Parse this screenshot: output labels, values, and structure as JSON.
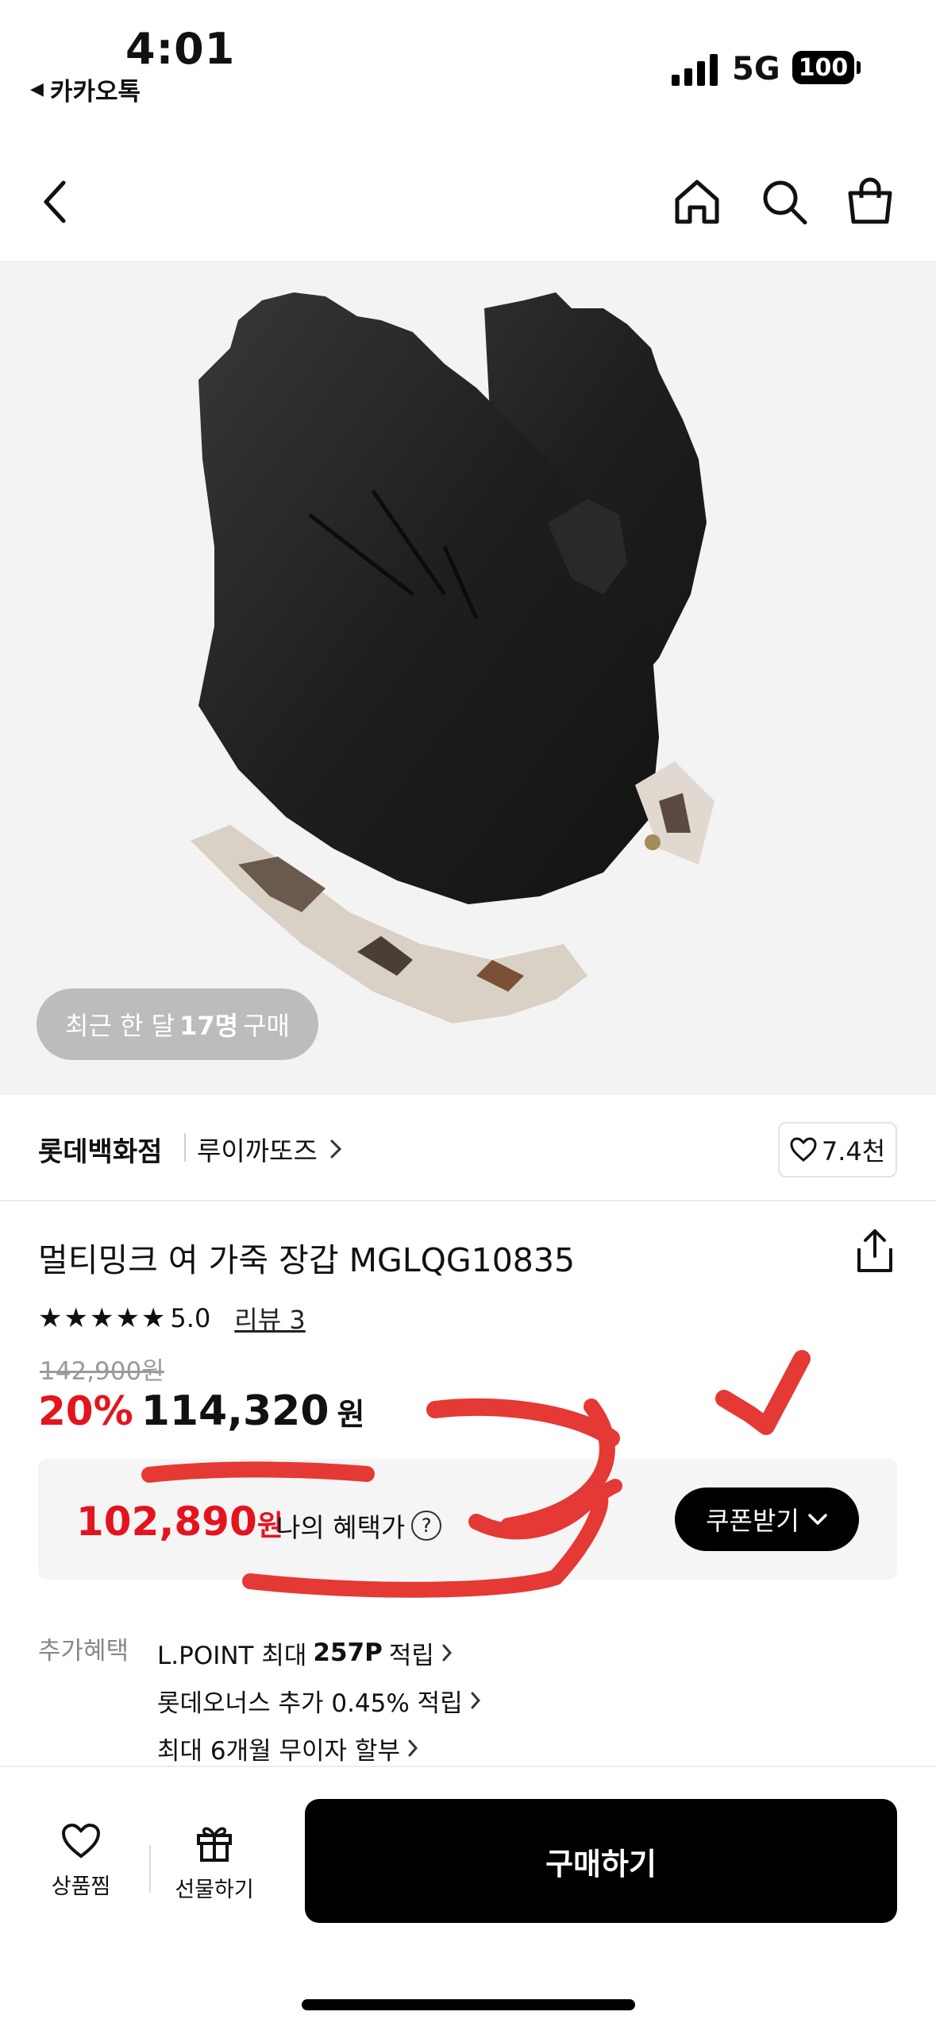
{
  "status_bar": {
    "time": "4:01",
    "back_app": "카카오톡",
    "network": "5G",
    "battery": "100"
  },
  "header": {
    "icons": [
      "back-icon",
      "home-icon",
      "search-icon",
      "shopping-bag-icon"
    ]
  },
  "product_image": {
    "recent_prefix": "최근 한 달",
    "recent_count": "17명",
    "recent_suffix": "구매"
  },
  "brand": {
    "store": "롯데백화점",
    "name": "루이까또즈",
    "likes": "7.4천"
  },
  "product": {
    "title": "멀티밍크 여 가죽 장갑 MGLQG10835",
    "stars": "★★★★★",
    "rating": "5.0",
    "review_label": "리뷰 3",
    "original_price": "142,900원",
    "discount": "20%",
    "sale_price": "114,320",
    "sale_unit": "원"
  },
  "benefit": {
    "my_price": "102,890",
    "my_price_unit": "원",
    "label": "나의 혜택가",
    "help": "?",
    "coupon_button": "쿠폰받기"
  },
  "extra_benefits": {
    "label": "추가혜택",
    "item1_pre": "L.POINT 최대 ",
    "item1_bold": "257P",
    "item1_post": " 적립",
    "item2": "롯데오너스 추가 0.45% 적립",
    "item3": "최대 6개월 무이자 할부"
  },
  "bottom_bar": {
    "wishlist": "상품찜",
    "gift": "선물하기",
    "buy": "구매하기"
  },
  "colors": {
    "accent_red": "#e4141f",
    "annotation_red": "#e53935"
  }
}
